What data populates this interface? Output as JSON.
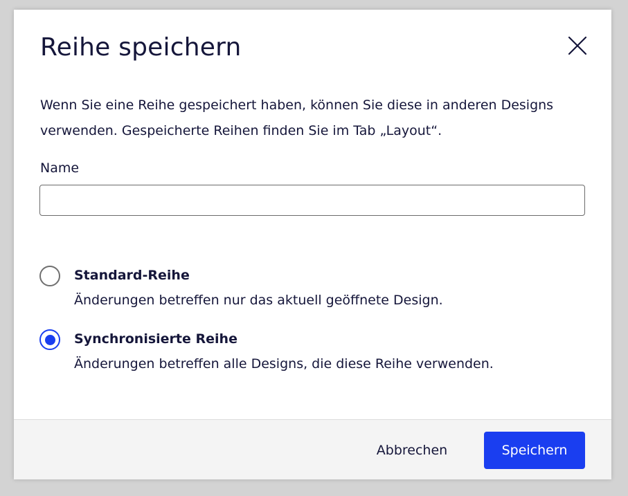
{
  "dialog": {
    "title": "Reihe speichern",
    "description": "Wenn Sie eine Reihe gespeichert haben, können Sie diese in anderen Designs verwenden. Gespeicherte Reihen finden Sie im Tab „Layout“.",
    "close_icon": "close-icon"
  },
  "name_field": {
    "label": "Name",
    "value": "",
    "placeholder": ""
  },
  "options": [
    {
      "title": "Standard-Reihe",
      "description": "Änderungen betreffen nur das aktuell geöffnete Design.",
      "selected": false
    },
    {
      "title": "Synchronisierte Reihe",
      "description": "Änderungen betreffen alle Designs, die diese Reihe verwenden.",
      "selected": true
    }
  ],
  "footer": {
    "cancel_label": "Abbrechen",
    "save_label": "Speichern"
  },
  "colors": {
    "accent": "#1a3ef0",
    "text": "#15163a",
    "footer_bg": "#f4f4f4",
    "backdrop": "#d3d3d3"
  }
}
